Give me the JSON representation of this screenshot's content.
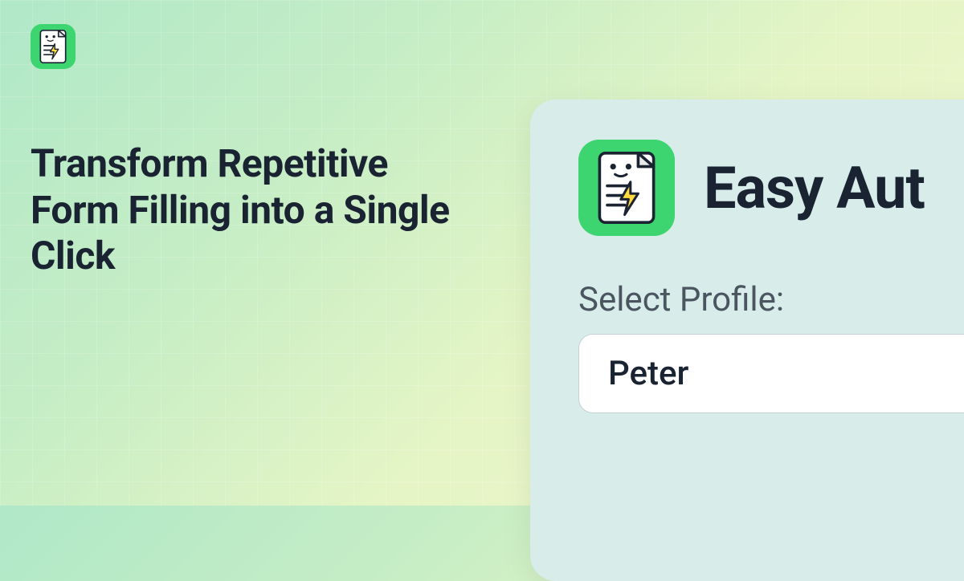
{
  "headline": "Transform Repetitive Form Filling into a Single Click",
  "panel": {
    "title": "Easy Aut",
    "profile_label": "Select Profile:",
    "profile_value": "Peter"
  }
}
